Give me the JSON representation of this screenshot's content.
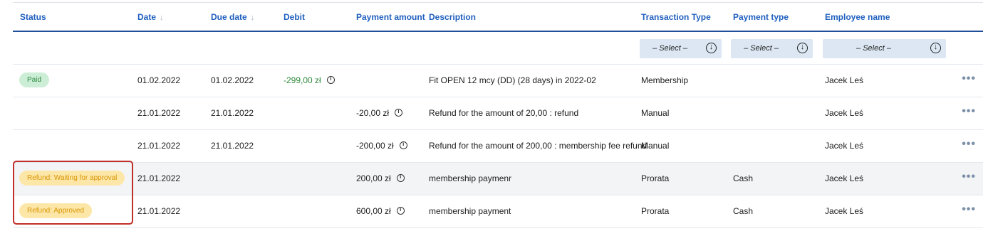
{
  "table": {
    "headers": {
      "status": "Status",
      "date": "Date",
      "due_date": "Due date",
      "debit": "Debit",
      "payment_amount": "Payment amount",
      "description": "Description",
      "transaction_type": "Transaction Type",
      "payment_type": "Payment type",
      "employee_name": "Employee name"
    },
    "sort_icon": "arrow-down-icon",
    "filters": {
      "transaction_type": "– Select –",
      "payment_type": "– Select –",
      "employee_name": "– Select –"
    },
    "rows": [
      {
        "status": "Paid",
        "status_kind": "paid",
        "date": "01.02.2022",
        "due_date": "01.02.2022",
        "debit": "-299,00 zł",
        "payment_amount": "",
        "description": "Fit OPEN 12 mcy (DD) (28 days) in 2022-02",
        "transaction_type": "Membership",
        "payment_type": "",
        "employee_name": "Jacek Leś",
        "more": "•••"
      },
      {
        "status": "",
        "status_kind": "",
        "date": "21.01.2022",
        "due_date": "21.01.2022",
        "debit": "",
        "payment_amount": "-20,00 zł",
        "description": "Refund for the amount of 20,00 : refund",
        "transaction_type": "Manual",
        "payment_type": "",
        "employee_name": "Jacek Leś",
        "more": "•••"
      },
      {
        "status": "",
        "status_kind": "",
        "date": "21.01.2022",
        "due_date": "21.01.2022",
        "debit": "",
        "payment_amount": "-200,00 zł",
        "description": "Refund for the amount of 200,00 : membership fee refund",
        "transaction_type": "Manual",
        "payment_type": "",
        "employee_name": "Jacek Leś",
        "more": "•••"
      },
      {
        "status": "Refund: Waiting for approval",
        "status_kind": "refund",
        "date": "21.01.2022",
        "due_date": "",
        "debit": "",
        "payment_amount": "200,00 zł",
        "description": "membership paymenr",
        "transaction_type": "Prorata",
        "payment_type": "Cash",
        "employee_name": "Jacek Leś",
        "more": "•••"
      },
      {
        "status": "Refund: Approved",
        "status_kind": "refund",
        "date": "21.01.2022",
        "due_date": "",
        "debit": "",
        "payment_amount": "600,00 zł",
        "description": "membership payment",
        "transaction_type": "Prorata",
        "payment_type": "Cash",
        "employee_name": "Jacek Leś",
        "more": "•••"
      }
    ]
  },
  "colors": {
    "header_text": "#1f5fbf",
    "debit_text": "#2e8b3a",
    "paid_badge_bg": "#cdeed6",
    "refund_badge_bg": "#fde7a8",
    "highlight_border": "#c0302b"
  }
}
